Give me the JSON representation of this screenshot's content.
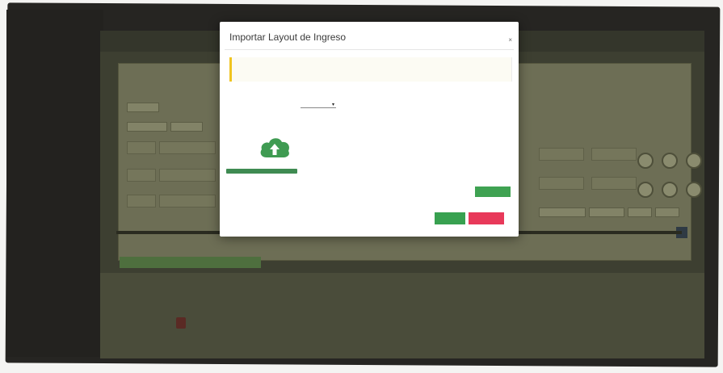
{
  "background_app": {
    "breadcrumb": "",
    "panel_title": "",
    "column_headers": [
      "",
      ""
    ],
    "footer_left_caption": "",
    "footer_center_caption": "",
    "footer_right_caption": ""
  },
  "modal": {
    "title": "Importar Layout de Ingreso",
    "close_glyph": "×",
    "alert_text": "",
    "field_label": "",
    "select_value": "",
    "file_label": "",
    "drop_text": "",
    "buttons": {
      "green": "",
      "ok": "",
      "cancel": ""
    }
  },
  "colors": {
    "modal_bg": "#ffffff",
    "alert_accent": "#f0c420",
    "cloud_icon": "#3f9b52",
    "primary_green": "#38a150",
    "danger_red": "#e8395a",
    "dim_app_bg": "#3d3f31"
  },
  "icons": {
    "upload": "cloud-upload-icon",
    "close": "close-icon",
    "select_arrow": "caret-down-icon"
  }
}
